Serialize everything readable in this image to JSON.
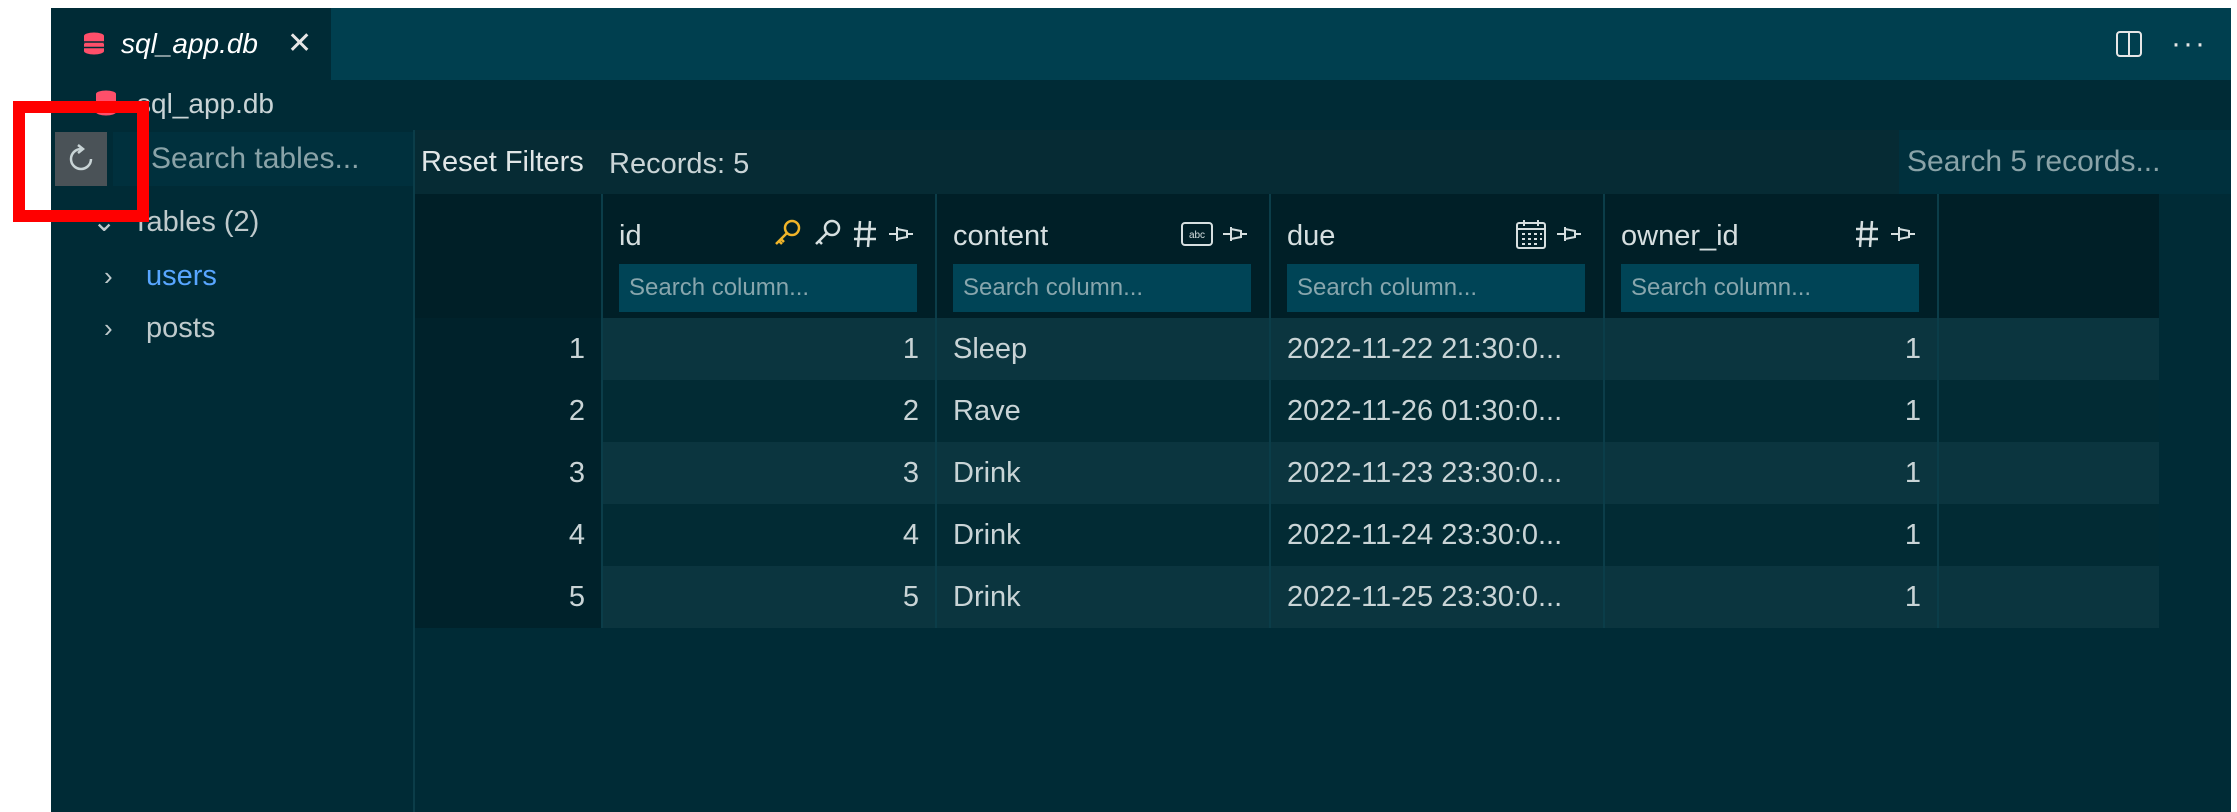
{
  "tab": {
    "title": "sql_app.db",
    "close_glyph": "✕"
  },
  "breadcrumb": {
    "label": "sql_app.db"
  },
  "sidebar": {
    "search_placeholder": "Search tables...",
    "tree_header": "Tables (2)",
    "items": [
      {
        "label": "users",
        "active": true
      },
      {
        "label": "posts",
        "active": false
      }
    ]
  },
  "toolbar": {
    "reset_label": "Reset Filters",
    "records_label": "Records: 5",
    "search_placeholder": "Search 5 records..."
  },
  "columns": [
    {
      "name": "id",
      "search_placeholder": "Search column...",
      "icons": [
        "key-icon",
        "key-outline-icon",
        "hash-icon",
        "pin-icon"
      ]
    },
    {
      "name": "content",
      "search_placeholder": "Search column...",
      "icons": [
        "text-type-icon",
        "pin-icon"
      ]
    },
    {
      "name": "due",
      "search_placeholder": "Search column...",
      "icons": [
        "calendar-icon",
        "pin-icon"
      ]
    },
    {
      "name": "owner_id",
      "search_placeholder": "Search column...",
      "icons": [
        "hash-icon",
        "pin-icon"
      ]
    }
  ],
  "rows": [
    {
      "index": "1",
      "id": "1",
      "content": "Sleep",
      "due": "2022-11-22 21:30:0...",
      "owner_id": "1"
    },
    {
      "index": "2",
      "id": "2",
      "content": "Rave",
      "due": "2022-11-26 01:30:0...",
      "owner_id": "1"
    },
    {
      "index": "3",
      "id": "3",
      "content": "Drink",
      "due": "2022-11-23 23:30:0...",
      "owner_id": "1"
    },
    {
      "index": "4",
      "id": "4",
      "content": "Drink",
      "due": "2022-11-24 23:30:0...",
      "owner_id": "1"
    },
    {
      "index": "5",
      "id": "5",
      "content": "Drink",
      "due": "2022-11-25 23:30:0...",
      "owner_id": "1"
    }
  ],
  "colors": {
    "accent_red": "#ff0000",
    "db_icon": "#ff4f6a",
    "active_link": "#58a6ff",
    "key_icon": "#f0b429"
  }
}
